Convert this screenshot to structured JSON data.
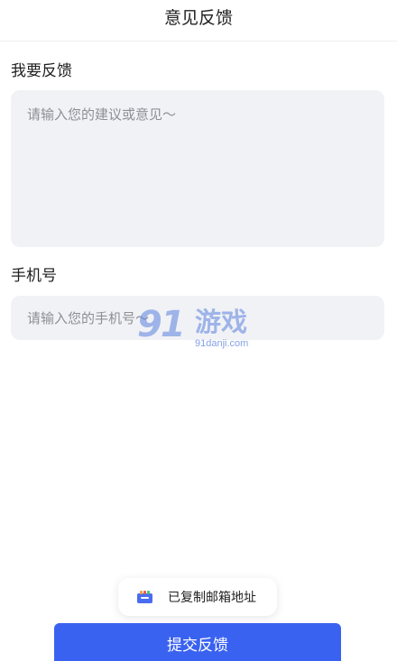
{
  "nav": {
    "title": "意见反馈"
  },
  "feedback": {
    "label": "我要反馈",
    "placeholder": "请输入您的建议或意见～",
    "value": ""
  },
  "phone": {
    "label": "手机号",
    "placeholder": "请输入您的手机号～",
    "value": ""
  },
  "watermark": {
    "number": "91",
    "text": "游戏",
    "domain": "91danji.com"
  },
  "toast": {
    "icon": "clipboard-icon",
    "text": "已复制邮箱地址"
  },
  "submit": {
    "label": "提交反馈"
  },
  "colors": {
    "primary": "#3a62f1",
    "input_bg": "#f1f2f6",
    "placeholder": "#8e8f94"
  }
}
